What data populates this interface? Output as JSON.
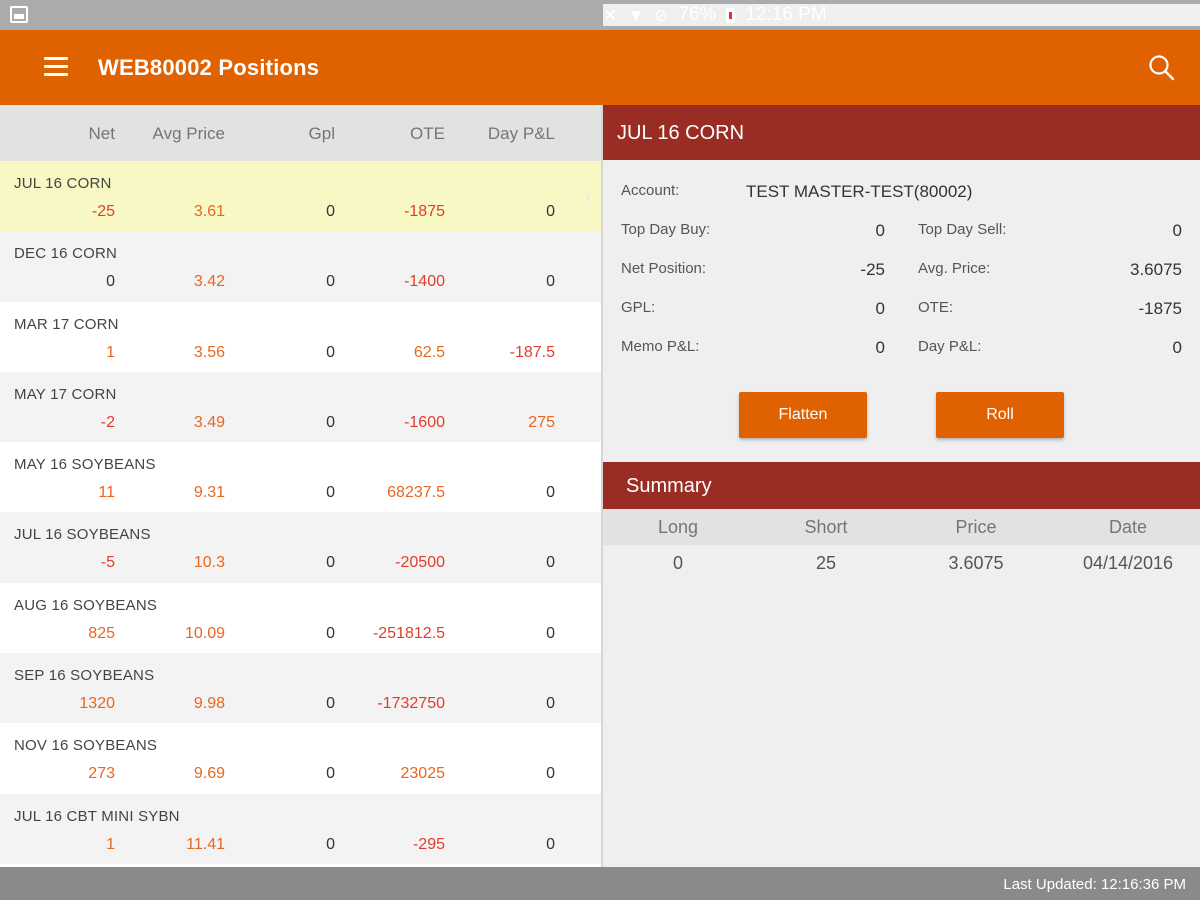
{
  "status": {
    "battery": "76%",
    "time": "12:16 PM"
  },
  "appbar": {
    "title": "WEB80002 Positions"
  },
  "columns": [
    "Net",
    "Avg Price",
    "Gpl",
    "OTE",
    "Day P&L"
  ],
  "positions": [
    {
      "name": "JUL 16 CORN",
      "net": "-25",
      "avg": "3.61",
      "gpl": "0",
      "ote": "-1875",
      "day": "0"
    },
    {
      "name": "DEC 16 CORN",
      "net": "0",
      "avg": "3.42",
      "gpl": "0",
      "ote": "-1400",
      "day": "0"
    },
    {
      "name": "MAR 17 CORN",
      "net": "1",
      "avg": "3.56",
      "gpl": "0",
      "ote": "62.5",
      "day": "-187.5"
    },
    {
      "name": "MAY 17 CORN",
      "net": "-2",
      "avg": "3.49",
      "gpl": "0",
      "ote": "-1600",
      "day": "275"
    },
    {
      "name": "MAY 16 SOYBEANS",
      "net": "11",
      "avg": "9.31",
      "gpl": "0",
      "ote": "68237.5",
      "day": "0"
    },
    {
      "name": "JUL 16 SOYBEANS",
      "net": "-5",
      "avg": "10.3",
      "gpl": "0",
      "ote": "-20500",
      "day": "0"
    },
    {
      "name": "AUG 16 SOYBEANS",
      "net": "825",
      "avg": "10.09",
      "gpl": "0",
      "ote": "-251812.5",
      "day": "0"
    },
    {
      "name": "SEP 16 SOYBEANS",
      "net": "1320",
      "avg": "9.98",
      "gpl": "0",
      "ote": "-1732750",
      "day": "0"
    },
    {
      "name": "NOV 16 SOYBEANS",
      "net": "273",
      "avg": "9.69",
      "gpl": "0",
      "ote": "23025",
      "day": "0"
    },
    {
      "name": "JUL 16 CBT MINI SYBN",
      "net": "1",
      "avg": "11.41",
      "gpl": "0",
      "ote": "-295",
      "day": "0"
    }
  ],
  "detail": {
    "title": "JUL 16 CORN",
    "account_label": "Account:",
    "account_value": "TEST MASTER-TEST(80002)",
    "top_day_buy_label": "Top Day Buy:",
    "top_day_buy": "0",
    "top_day_sell_label": "Top Day Sell:",
    "top_day_sell": "0",
    "net_position_label": "Net Position:",
    "net_position": "-25",
    "avg_price_label": "Avg. Price:",
    "avg_price": "3.6075",
    "gpl_label": "GPL:",
    "gpl": "0",
    "ote_label": "OTE:",
    "ote": "-1875",
    "memo_pl_label": "Memo P&L:",
    "memo_pl": "0",
    "day_pl_label": "Day P&L:",
    "day_pl": "0",
    "flatten_label": "Flatten",
    "roll_label": "Roll"
  },
  "summary": {
    "title": "Summary",
    "columns": [
      "Long",
      "Short",
      "Price",
      "Date"
    ],
    "row": [
      "0",
      "25",
      "3.6075",
      "04/14/2016"
    ]
  },
  "footer": {
    "last_updated": "Last Updated: 12:16:36 PM"
  },
  "colors": {
    "accent": "#e06100",
    "detail_header": "#9a2d23",
    "negative": "#e23d2c",
    "value_orange": "#e8671f",
    "selected_row": "#f8f8c4"
  }
}
